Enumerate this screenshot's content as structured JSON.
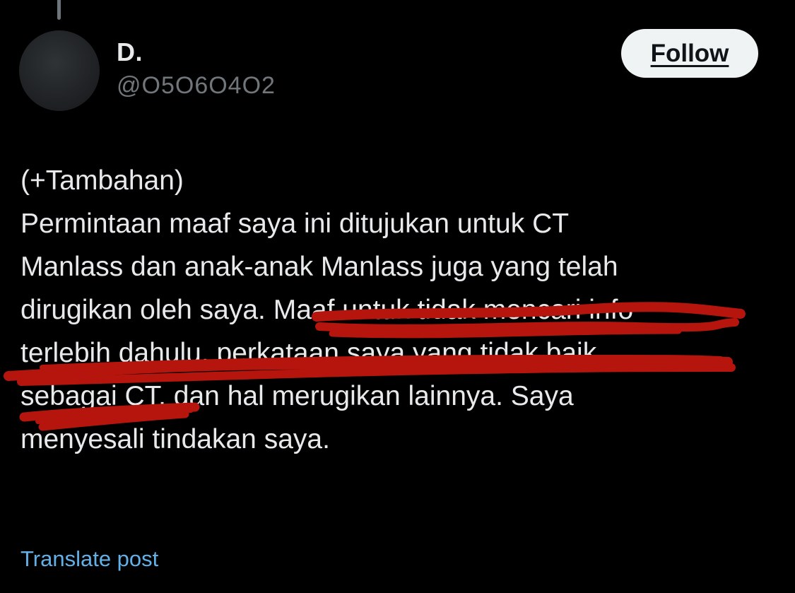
{
  "author": {
    "display_name": "D.",
    "handle": "@O5O6O4O2"
  },
  "actions": {
    "follow_label": "Follow"
  },
  "post": {
    "lines": [
      "(+Tambahan)",
      "Permintaan maaf saya ini ditujukan untuk CT",
      "Manlass dan anak-anak Manlass juga yang telah",
      "dirugikan oleh saya. Maaf untuk tidak mencari info",
      "terlebih dahulu, perkataan saya yang tidak baik",
      "sebagai CT, dan hal merugikan lainnya. Saya",
      "menyesali tindakan saya."
    ]
  },
  "footer": {
    "translate_label": "Translate post"
  },
  "colors": {
    "background": "#000000",
    "text_primary": "#e7e9ea",
    "text_secondary": "#71767b",
    "link": "#62b0e8",
    "redaction": "#b5150c",
    "follow_bg": "#eff3f4"
  }
}
